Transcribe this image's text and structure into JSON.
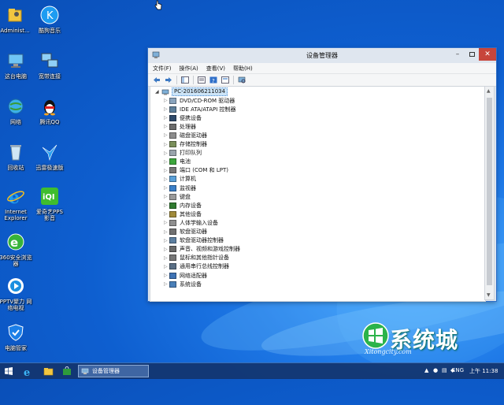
{
  "desktop": {
    "icons": [
      {
        "label": "Administ...",
        "icon": "user-folder-icon"
      },
      {
        "label": "酷狗音乐",
        "icon": "kugou-music-icon"
      },
      {
        "label": "这台电脑",
        "icon": "computer-icon"
      },
      {
        "label": "宽带连接",
        "icon": "network-connection-icon"
      },
      {
        "label": "网络",
        "icon": "network-globe-icon"
      },
      {
        "label": "腾讯QQ",
        "icon": "qq-penguin-icon"
      },
      {
        "label": "回收站",
        "icon": "recycle-bin-icon"
      },
      {
        "label": "迅雷极速版",
        "icon": "thunder-bird-icon"
      },
      {
        "label": "Internet\nExplorer",
        "icon": "internet-explorer-icon"
      },
      {
        "label": "爱奇艺PPS\n影音",
        "icon": "iqiyi-pps-icon"
      },
      {
        "label": "360安全浏览\n器",
        "icon": "360-browser-icon"
      },
      {
        "label": "PPTV聚力 网\n络电视",
        "icon": "pptv-icon"
      },
      {
        "label": "电脑管家",
        "icon": "pc-manager-shield-icon"
      }
    ]
  },
  "window": {
    "title": "设备管理器",
    "menu": [
      "文件(F)",
      "操作(A)",
      "查看(V)",
      "帮助(H)"
    ],
    "root": "PC-201606211034",
    "items": [
      {
        "label": "DVD/CD-ROM 驱动器",
        "icon": "dvd-drive-icon"
      },
      {
        "label": "IDE ATA/ATAPI 控制器",
        "icon": "ide-controller-icon"
      },
      {
        "label": "便携设备",
        "icon": "portable-device-icon"
      },
      {
        "label": "处理器",
        "icon": "processor-icon"
      },
      {
        "label": "磁盘驱动器",
        "icon": "disk-drive-icon"
      },
      {
        "label": "存储控制器",
        "icon": "storage-controller-icon"
      },
      {
        "label": "打印队列",
        "icon": "printer-icon"
      },
      {
        "label": "电池",
        "icon": "battery-icon"
      },
      {
        "label": "端口 (COM 和 LPT)",
        "icon": "port-icon"
      },
      {
        "label": "计算机",
        "icon": "computer-icon"
      },
      {
        "label": "监视器",
        "icon": "monitor-icon"
      },
      {
        "label": "键盘",
        "icon": "keyboard-icon"
      },
      {
        "label": "内存设备",
        "icon": "memory-icon"
      },
      {
        "label": "其他设备",
        "icon": "other-device-icon"
      },
      {
        "label": "人体学输入设备",
        "icon": "hid-icon"
      },
      {
        "label": "软盘驱动器",
        "icon": "floppy-drive-icon"
      },
      {
        "label": "软盘驱动器控制器",
        "icon": "floppy-controller-icon"
      },
      {
        "label": "声音、视频和游戏控制器",
        "icon": "sound-icon"
      },
      {
        "label": "鼠标和其他指针设备",
        "icon": "mouse-icon"
      },
      {
        "label": "通用串行总线控制器",
        "icon": "usb-icon"
      },
      {
        "label": "网络适配器",
        "icon": "network-adapter-icon"
      },
      {
        "label": "系统设备",
        "icon": "system-device-icon"
      }
    ]
  },
  "logo": {
    "main": "系统城",
    "sub": "Xitongcity.com"
  },
  "taskbar": {
    "task_label": "设备管理器",
    "lang": "ENG",
    "time": "上午 11:38"
  },
  "colors": {
    "desktop": "#1e78e6",
    "taskbar": "#12346e",
    "selection": "#cce4f7"
  }
}
